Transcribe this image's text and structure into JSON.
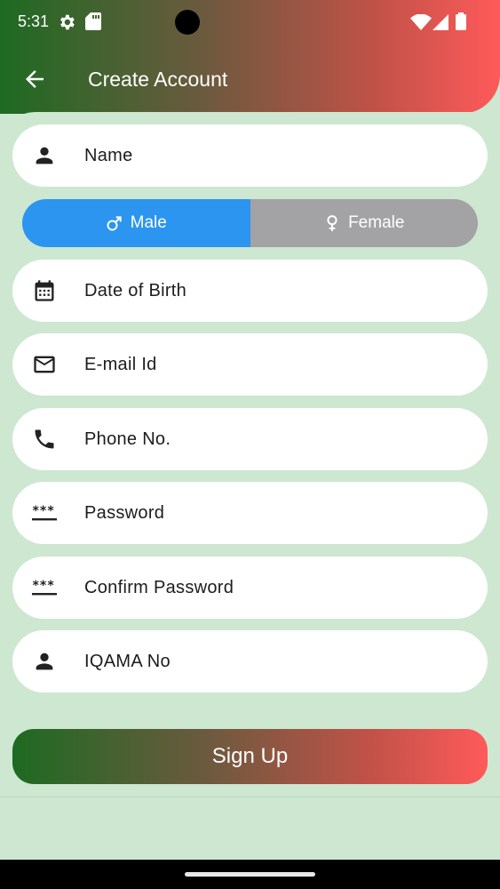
{
  "status": {
    "time": "5:31"
  },
  "header": {
    "title": "Create Account"
  },
  "fields": {
    "name": "Name",
    "dob": "Date of Birth",
    "email": "E-mail Id",
    "phone": "Phone No.",
    "password": "Password",
    "confirm_password": "Confirm Password",
    "iqama": "IQAMA No"
  },
  "gender": {
    "male": "Male",
    "female": "Female",
    "selected": "Male"
  },
  "signup": {
    "label": "Sign Up"
  },
  "colors": {
    "accent_blue": "#2b95f0",
    "gradient_start": "#1e6a22",
    "gradient_end": "#ff5a5a",
    "background": "#cde7d0",
    "unselected_gray": "#a3a2a4"
  },
  "icons": {
    "back": "arrow-left-icon",
    "name": "person-icon",
    "dob": "calendar-icon",
    "email": "mail-icon",
    "phone": "phone-icon",
    "password": "password-dots-icon",
    "iqama": "person-icon"
  }
}
